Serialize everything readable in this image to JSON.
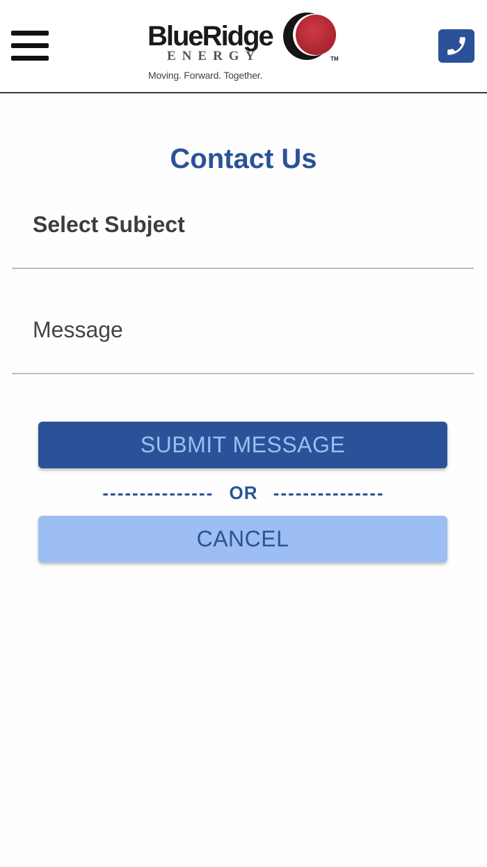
{
  "header": {
    "menu_icon": "hamburger-menu-icon",
    "logo": {
      "name": "BlueRidge",
      "sub": "ENERGY",
      "trademark": "TM",
      "tagline": "Moving. Forward. Together."
    },
    "phone_icon": "phone-icon"
  },
  "page": {
    "title": "Contact Us"
  },
  "form": {
    "subject_label": "Select Subject",
    "message_label": "Message"
  },
  "actions": {
    "submit_label": "SUBMIT MESSAGE",
    "or_left": "---------------",
    "or_text": "OR",
    "or_right": "---------------",
    "cancel_label": "CANCEL"
  },
  "colors": {
    "brand_blue": "#2b5298",
    "light_blue": "#9cbef2",
    "logo_red": "#c0303a"
  }
}
